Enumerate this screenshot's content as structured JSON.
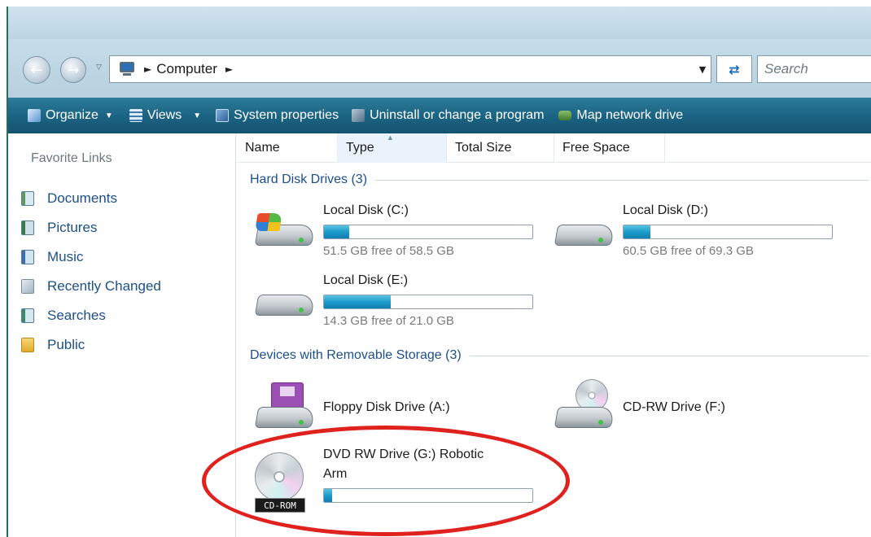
{
  "address": {
    "crumb": "Computer",
    "search_placeholder": "Search"
  },
  "toolbar": {
    "organize": "Organize",
    "views": "Views",
    "system_properties": "System properties",
    "uninstall": "Uninstall or change a program",
    "map_network": "Map network drive"
  },
  "nav": {
    "title": "Favorite Links",
    "items": [
      {
        "label": "Documents",
        "icon": "documents-icon"
      },
      {
        "label": "Pictures",
        "icon": "pictures-icon"
      },
      {
        "label": "Music",
        "icon": "music-icon"
      },
      {
        "label": "Recently Changed",
        "icon": "recently-changed-icon"
      },
      {
        "label": "Searches",
        "icon": "searches-icon"
      },
      {
        "label": "Public",
        "icon": "public-folder-icon"
      }
    ]
  },
  "columns": [
    "Name",
    "Type",
    "Total Size",
    "Free Space"
  ],
  "groups": {
    "hard_disks": "Hard Disk Drives (3)",
    "removable": "Devices with Removable Storage (3)"
  },
  "drives": {
    "c": {
      "label": "Local Disk (C:)",
      "free": "51.5 GB free of 58.5 GB",
      "used_fraction": 0.12
    },
    "d": {
      "label": "Local Disk (D:)",
      "free": "60.5 GB free of 69.3 GB",
      "used_fraction": 0.13
    },
    "e": {
      "label": "Local Disk (E:)",
      "free": "14.3 GB free of 21.0 GB",
      "used_fraction": 0.32
    },
    "a": {
      "label": "Floppy Disk Drive (A:)"
    },
    "f": {
      "label": "CD-RW Drive (F:)"
    },
    "g": {
      "label_line1": "DVD RW Drive (G:) Robotic",
      "label_line2": "Arm",
      "badge": "CD-ROM",
      "used_fraction": 0.04
    }
  },
  "colors": {
    "toolbar": "#1c6484",
    "link": "#1c4f8a",
    "bar_fill": "#1d9ccc",
    "annotation": "#e0221f"
  }
}
